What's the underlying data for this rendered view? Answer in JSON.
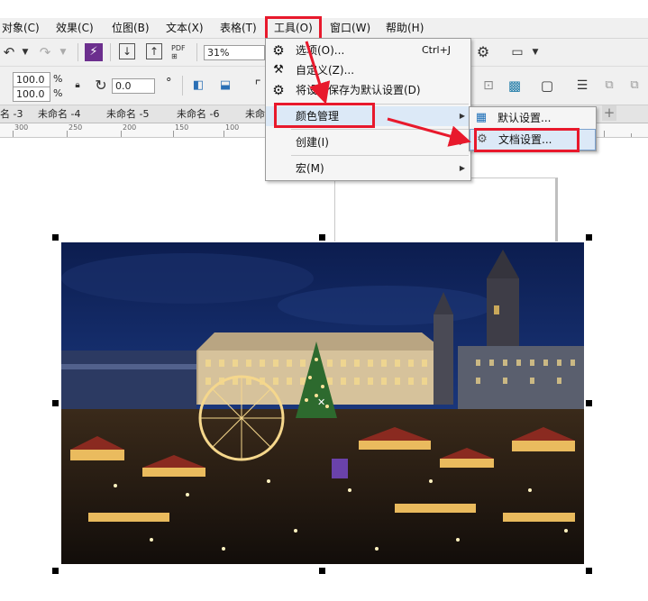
{
  "menubar": {
    "items": [
      {
        "label": "对象(C)"
      },
      {
        "label": "效果(C)"
      },
      {
        "label": "位图(B)"
      },
      {
        "label": "文本(X)"
      },
      {
        "label": "表格(T)"
      },
      {
        "label": "工具(O)"
      },
      {
        "label": "窗口(W)"
      },
      {
        "label": "帮助(H)"
      }
    ]
  },
  "toolbar": {
    "zoom_value": "31%",
    "pdf_label": "PDF",
    "scale_x": "100.0",
    "scale_y": "100.0",
    "percent_x": "%",
    "percent_y": "%",
    "rotate_value": "0.0",
    "degree_symbol": "°"
  },
  "tabs": [
    "名 -3",
    "未命名 -4",
    "未命名 -5",
    "未命名 -6",
    "未命名"
  ],
  "add_tab": "+",
  "ruler": {
    "labels": [
      "300",
      "250",
      "200",
      "150",
      "100"
    ]
  },
  "tools_menu": {
    "items": [
      {
        "label": "选项(O)...",
        "shortcut": "Ctrl+J",
        "icon": "gear-icon"
      },
      {
        "label": "自定义(Z)...",
        "icon": "customize-icon"
      },
      {
        "label": "将设置保存为默认设置(D)",
        "icon": "save-settings-icon"
      },
      {
        "label": "颜色管理",
        "icon": "none"
      },
      {
        "label": "创建(I)",
        "icon": "none"
      },
      {
        "label": "宏(M)",
        "icon": "none"
      }
    ]
  },
  "color_mgmt_submenu": {
    "items": [
      {
        "label": "默认设置...",
        "icon": "color-palette-icon"
      },
      {
        "label": "文档设置...",
        "icon": "document-color-icon"
      }
    ]
  },
  "colors": {
    "highlight": "#e8192c",
    "menu_bg": "#f5f5f5",
    "toolbar_bg": "#f0f0f0"
  },
  "image_description_icon": "christmas-market-photo"
}
